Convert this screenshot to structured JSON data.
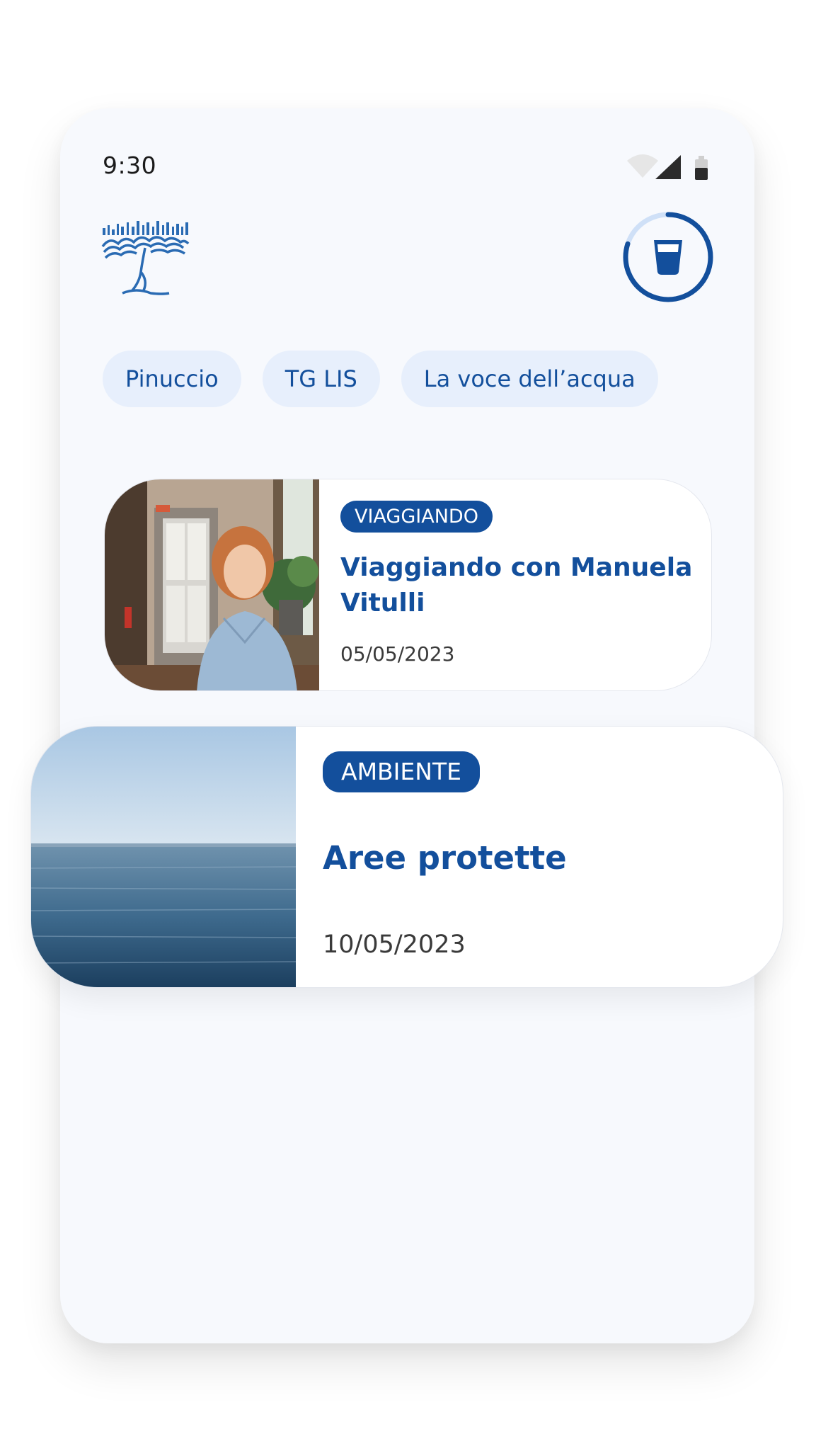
{
  "status_bar": {
    "time": "9:30",
    "icons": [
      "wifi-icon",
      "signal-icon",
      "battery-icon"
    ]
  },
  "header": {
    "logo_icon": "tree-logo-icon",
    "action_icon": "glass-icon",
    "progress": 0.8
  },
  "chips": [
    {
      "label": "Pinuccio"
    },
    {
      "label": "TG LIS"
    },
    {
      "label": "La voce dell’acqua"
    }
  ],
  "cards": [
    {
      "category": "VIAGGIANDO",
      "title": "Viaggiando con Manuela Vitulli",
      "date": "05/05/2023",
      "image": "woman-photo"
    },
    {
      "category": "AMBIENTE",
      "title": "Aree protette",
      "date": "10/05/2023",
      "image": "sea-photo"
    }
  ],
  "colors": {
    "accent": "#134f9c",
    "chip_bg": "#e7effc",
    "screen_bg": "#f7f9fd",
    "progress_track": "#cfe0f7"
  }
}
